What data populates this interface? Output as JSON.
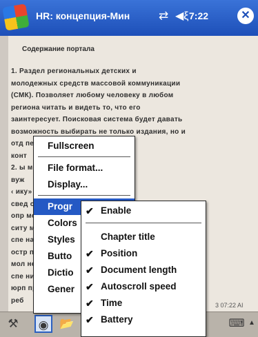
{
  "titlebar": {
    "title": "HR: концепция-Мин",
    "clock": "7:22",
    "close_glyph": "✕",
    "conn_glyph": "⇄",
    "volume_glyph": "◀ξ"
  },
  "document": {
    "heading": "Содержание портала",
    "lines": [
      "1.    Раздел    региональных    детских   и",
      "молодежных средств массовой коммуникации",
      "(СМК). Позволяет любому человеку в любом",
      "региона   читать   и   видеть   то,   что   его",
      "заинтересует. Поисковая система будет давать",
      "возможность выбирать не только издания, но и",
      "отд                       передачи,  производите",
      "конт",
      "2.                        ы моей школьник и",
      "вуж",
      "‹                   ику» – советы и мнения",
      "свед                   собираются в течение",
      "опр                          мости от",
      "ситу                         ментарии",
      "спе                            наиболее",
      "остр                       подростков,",
      "мол                          неков и",
      "спе                        низаций,",
      "юрп                          право",
      "реб"
    ],
    "date": "3 07:22 AI"
  },
  "main_menu": {
    "items": [
      {
        "label": "Fullscreen"
      },
      {
        "label": "File format..."
      },
      {
        "label": "Display..."
      },
      {
        "label": "Progress",
        "display": "Progr"
      },
      {
        "label": "Colors",
        "display": "Colors"
      },
      {
        "label": "Styles",
        "display": "Styles"
      },
      {
        "label": "Buttons",
        "display": "Butto"
      },
      {
        "label": "Dictionary",
        "display": "Dictio"
      },
      {
        "label": "General",
        "display": "Gener"
      }
    ],
    "highlighted": "Progress"
  },
  "sub_menu": {
    "items": [
      {
        "label": "Enable",
        "checked": true
      },
      {
        "label": "Chapter title",
        "checked": false
      },
      {
        "label": "Position",
        "checked": true
      },
      {
        "label": "Document length",
        "checked": true
      },
      {
        "label": "Autoscroll speed",
        "checked": true
      },
      {
        "label": "Time",
        "checked": true
      },
      {
        "label": "Battery",
        "checked": true
      }
    ],
    "check_glyph": "✔"
  },
  "bottombar": {
    "tools_icon": "⚒",
    "view_icon": "◉",
    "open_icon": "📂",
    "keyboard_icon": "⌨",
    "arrow_icon": "▲"
  },
  "colors": {
    "titlebar": "#1d4fb8",
    "highlight": "#2459c4",
    "page": "#ece7df"
  }
}
